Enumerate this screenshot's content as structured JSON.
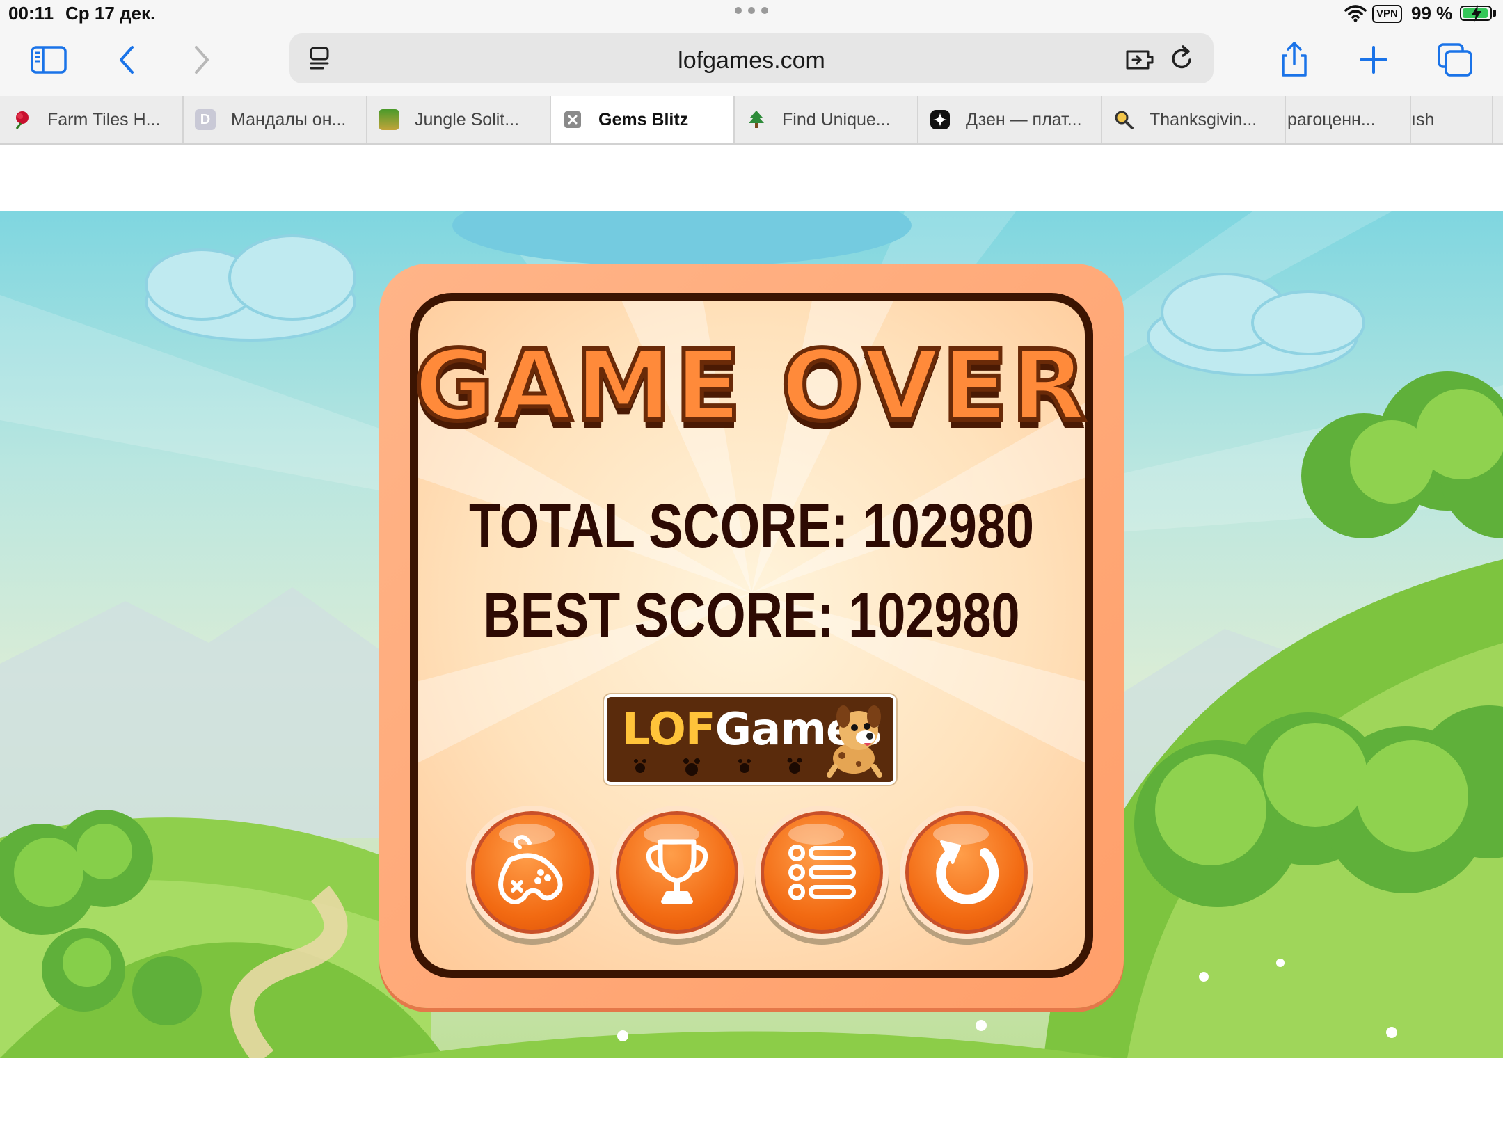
{
  "status_bar": {
    "time": "00:11",
    "date": "Ср 17 дек.",
    "vpn": "VPN",
    "battery": "99 %"
  },
  "toolbar": {
    "url": "lofgames.com",
    "icons": [
      "sidebar-icon",
      "back-icon",
      "forward-icon",
      "page-menu-icon",
      "extension-icon",
      "reload-icon",
      "share-icon",
      "new-tab-icon",
      "tabs-overview-icon"
    ]
  },
  "tabs": [
    {
      "label": "Farm Tiles H...",
      "icon": "rose-icon",
      "active": false
    },
    {
      "label": "Мандалы он...",
      "icon": "letter-d-icon",
      "active": false
    },
    {
      "label": "Jungle Solit...",
      "icon": "jungle-icon",
      "active": false
    },
    {
      "label": "Gems Blitz",
      "icon": "close-icon",
      "active": true
    },
    {
      "label": "Find Unique...",
      "icon": "tree-icon",
      "active": false
    },
    {
      "label": "Дзен — плат...",
      "icon": "zen-icon",
      "active": false
    },
    {
      "label": "Thanksgivin...",
      "icon": "search-icon",
      "active": false
    },
    {
      "label": "рагоценн...",
      "icon": "",
      "active": false
    },
    {
      "label": "ısh",
      "icon": "",
      "active": false
    }
  ],
  "game": {
    "title": "GAME OVER",
    "total_score": "TOTAL SCORE: 102980",
    "best_score": "BEST SCORE: 102980",
    "logo": {
      "prefix": "LOF",
      "suffix": "Games"
    },
    "buttons": [
      "more-games-icon",
      "trophy-icon",
      "menu-list-icon",
      "replay-icon"
    ],
    "colors": {
      "panel": "#ff9f6a",
      "frame": "#3b1402",
      "button": "#f26a12",
      "title": "#ff8a3a"
    }
  }
}
